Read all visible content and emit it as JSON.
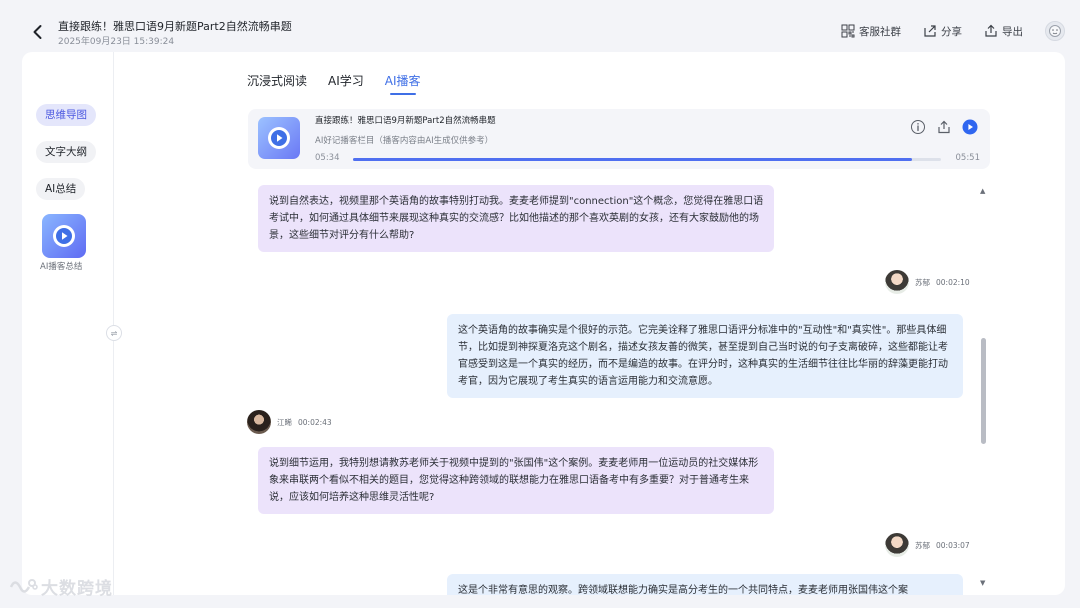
{
  "header": {
    "title": "直接跟练！雅思口语9月新题Part2自然流畅串题",
    "subtitle": "2025年09月23日 15:39:24",
    "actions": {
      "community": "客服社群",
      "share": "分享",
      "export": "导出"
    }
  },
  "sidebar": {
    "items": [
      {
        "label": "思维导图",
        "active": true
      },
      {
        "label": "文字大纲",
        "active": false
      },
      {
        "label": "AI总结",
        "active": false
      }
    ],
    "ai_podcast_label": "AI播客总结",
    "collapse_glyph": "⇌"
  },
  "tabs": [
    {
      "label": "沉浸式阅读",
      "active": false
    },
    {
      "label": "AI学习",
      "active": false
    },
    {
      "label": "AI播客",
      "active": true
    }
  ],
  "player": {
    "title": "直接跟练！雅思口语9月新题Part2自然流畅串题",
    "subtitle": "AI好记播客栏目（播客内容由AI生成仅供参考）",
    "current_time": "05:34",
    "total_time": "05:51",
    "progress_fraction": 0.951
  },
  "messages": [
    {
      "side": "left",
      "text": "说到自然表达，视频里那个英语角的故事特别打动我。麦麦老师提到\"connection\"这个概念，您觉得在雅思口语考试中，如何通过具体细节来展现这种真实的交流感？比如他描述的那个喜欢英剧的女孩，还有大家鼓励他的场景，这些细节对评分有什么帮助?"
    },
    {
      "side": "right",
      "speaker": "苏郁",
      "time": "00:02:10",
      "text": "这个英语角的故事确实是个很好的示范。它完美诠释了雅思口语评分标准中的\"互动性\"和\"真实性\"。那些具体细节，比如提到神探夏洛克这个剧名，描述女孩友善的微笑，甚至提到自己当时说的句子支离破碎，这些都能让考官感受到这是一个真实的经历，而不是编造的故事。在评分时，这种真实的生活细节往往比华丽的辞藻更能打动考官，因为它展现了考生真实的语言运用能力和交流意愿。"
    },
    {
      "side": "left",
      "speaker": "江晞",
      "time": "00:02:43",
      "text": "说到细节运用，我特别想请教苏老师关于视频中提到的\"张国伟\"这个案例。麦麦老师用一位运动员的社交媒体形象来串联两个看似不相关的题目，您觉得这种跨领域的联想能力在雅思口语备考中有多重要？对于普通考生来说，应该如何培养这种思维灵活性呢?"
    },
    {
      "side": "right",
      "speaker": "苏郁",
      "time": "00:03:07",
      "text": "这是个非常有意思的观察。跨领域联想能力确实是高分考生的一个共同特点，麦麦老师用张国伟这个案"
    }
  ],
  "watermark": "大数跨境",
  "colors": {
    "accent": "#3f6fe6",
    "bubble_left": "#ece3fb",
    "bubble_right": "#e6f0fd"
  },
  "icons": {
    "back": "chevron-left-icon",
    "community": "qr-grid-icon",
    "share": "share-icon",
    "export": "export-icon",
    "info": "info-icon",
    "player_share": "share-icon",
    "play": "play-icon"
  }
}
